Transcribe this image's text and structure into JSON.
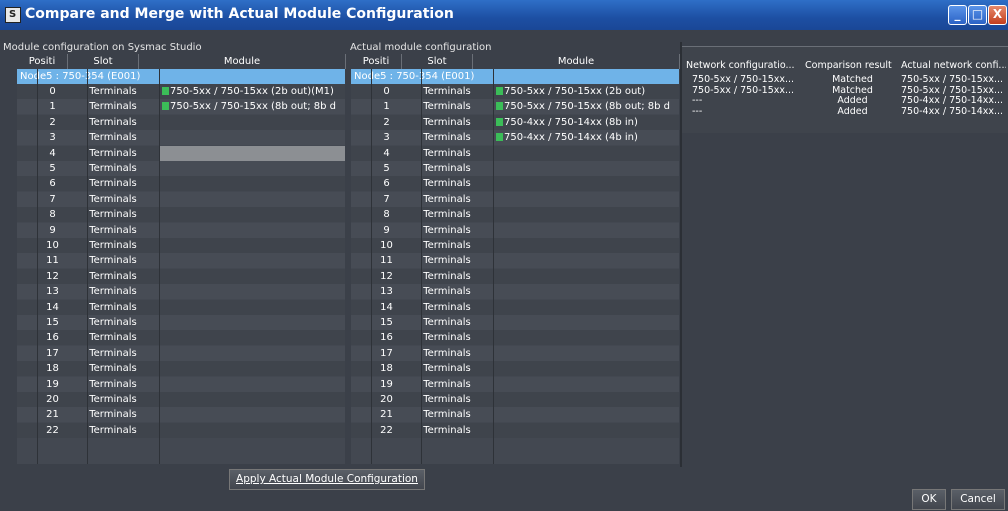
{
  "window": {
    "title": "Compare and Merge with Actual Module Configuration",
    "min_label": "_",
    "max_label": "□",
    "close_label": "X"
  },
  "left": {
    "label": "Module configuration on Sysmac Studio",
    "headers": {
      "position": "Positi",
      "slot": "Slot",
      "module": "Module"
    },
    "node": "Node5 : 750-354 (E001)",
    "modules": [
      "750-5xx / 750-15xx (2b out)(M1)",
      "750-5xx / 750-15xx (8b out; 8b d"
    ]
  },
  "actual": {
    "label": "Actual module configuration",
    "headers": {
      "position": "Positi",
      "slot": "Slot",
      "module": "Module"
    },
    "node": "Node5 : 750-354 (E001)",
    "modules": [
      "750-5xx / 750-15xx (2b out)",
      "750-5xx / 750-15xx (8b out; 8b d",
      "750-4xx / 750-14xx (8b in)",
      "750-4xx / 750-14xx (4b in)"
    ]
  },
  "rows": [
    {
      "pos": "0",
      "slot": "Terminals"
    },
    {
      "pos": "1",
      "slot": "Terminals"
    },
    {
      "pos": "2",
      "slot": "Terminals"
    },
    {
      "pos": "3",
      "slot": "Terminals"
    },
    {
      "pos": "4",
      "slot": "Terminals"
    },
    {
      "pos": "5",
      "slot": "Terminals"
    },
    {
      "pos": "6",
      "slot": "Terminals"
    },
    {
      "pos": "7",
      "slot": "Terminals"
    },
    {
      "pos": "8",
      "slot": "Terminals"
    },
    {
      "pos": "9",
      "slot": "Terminals"
    },
    {
      "pos": "10",
      "slot": "Terminals"
    },
    {
      "pos": "11",
      "slot": "Terminals"
    },
    {
      "pos": "12",
      "slot": "Terminals"
    },
    {
      "pos": "13",
      "slot": "Terminals"
    },
    {
      "pos": "14",
      "slot": "Terminals"
    },
    {
      "pos": "15",
      "slot": "Terminals"
    },
    {
      "pos": "16",
      "slot": "Terminals"
    },
    {
      "pos": "17",
      "slot": "Terminals"
    },
    {
      "pos": "18",
      "slot": "Terminals"
    },
    {
      "pos": "19",
      "slot": "Terminals"
    },
    {
      "pos": "20",
      "slot": "Terminals"
    },
    {
      "pos": "21",
      "slot": "Terminals"
    },
    {
      "pos": "22",
      "slot": "Terminals"
    }
  ],
  "comparison": {
    "headers": [
      "Network configuratio...",
      "Comparison result",
      "Actual network confi..."
    ],
    "rows": [
      [
        "750-5xx / 750-15xx...",
        "Matched",
        "750-5xx / 750-15xx..."
      ],
      [
        "750-5xx / 750-15xx...",
        "Matched",
        "750-5xx / 750-15xx..."
      ],
      [
        "---",
        "Added",
        "750-4xx / 750-14xx..."
      ],
      [
        "---",
        "Added",
        "750-4xx / 750-14xx..."
      ]
    ]
  },
  "buttons": {
    "apply": "Apply Actual Module Configuration",
    "ok": "OK",
    "cancel": "Cancel"
  },
  "colors": {
    "titlebar": "#1d4fa3",
    "node_highlight": "#6fb3e8",
    "module_icon": "#3bbd58"
  }
}
